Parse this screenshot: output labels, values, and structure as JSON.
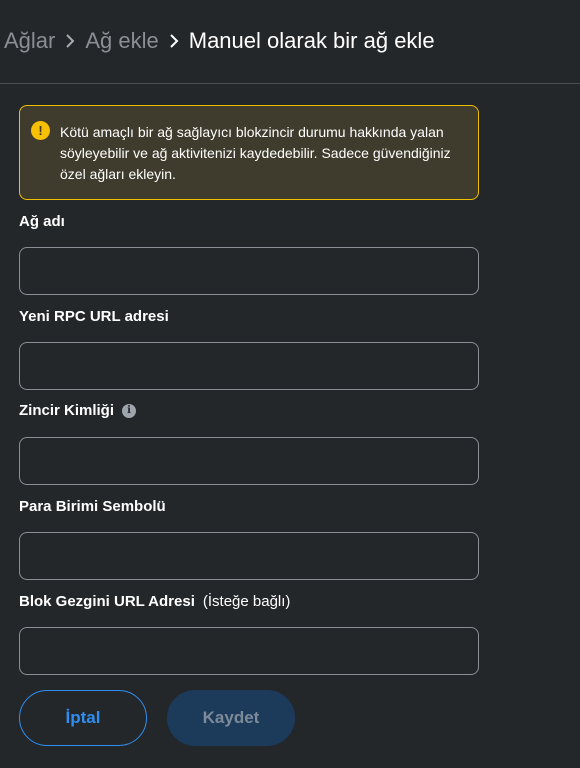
{
  "breadcrumb": {
    "items": [
      "Ağlar",
      "Ağ ekle"
    ],
    "current": "Manuel olarak bir ağ ekle"
  },
  "warning": {
    "icon": "warning-icon",
    "text": "Kötü amaçlı bir ağ sağlayıcı blokzincir durumu hakkında yalan söyleyebilir ve ağ aktivitenizi kaydedebilir. Sadece güvendiğiniz özel ağları ekleyin."
  },
  "form": {
    "network_name": {
      "label": "Ağ adı",
      "value": "",
      "placeholder": ""
    },
    "rpc_url": {
      "label": "Yeni RPC URL adresi",
      "value": "",
      "placeholder": ""
    },
    "chain_id": {
      "label": "Zincir Kimliği",
      "value": "",
      "placeholder": "",
      "icon": "info-icon"
    },
    "currency_symbol": {
      "label": "Para Birimi Sembolü",
      "value": "",
      "placeholder": ""
    },
    "explorer_url": {
      "label": "Blok Gezgini URL Adresi",
      "optional": "(İsteğe bağlı)",
      "value": "",
      "placeholder": ""
    }
  },
  "actions": {
    "cancel_label": "İptal",
    "save_label": "Kaydet"
  },
  "colors": {
    "background": "#24272a",
    "accent": "#2f8ef0",
    "warning_border": "#f0c000",
    "warning_bg": "#3f3b2d"
  }
}
